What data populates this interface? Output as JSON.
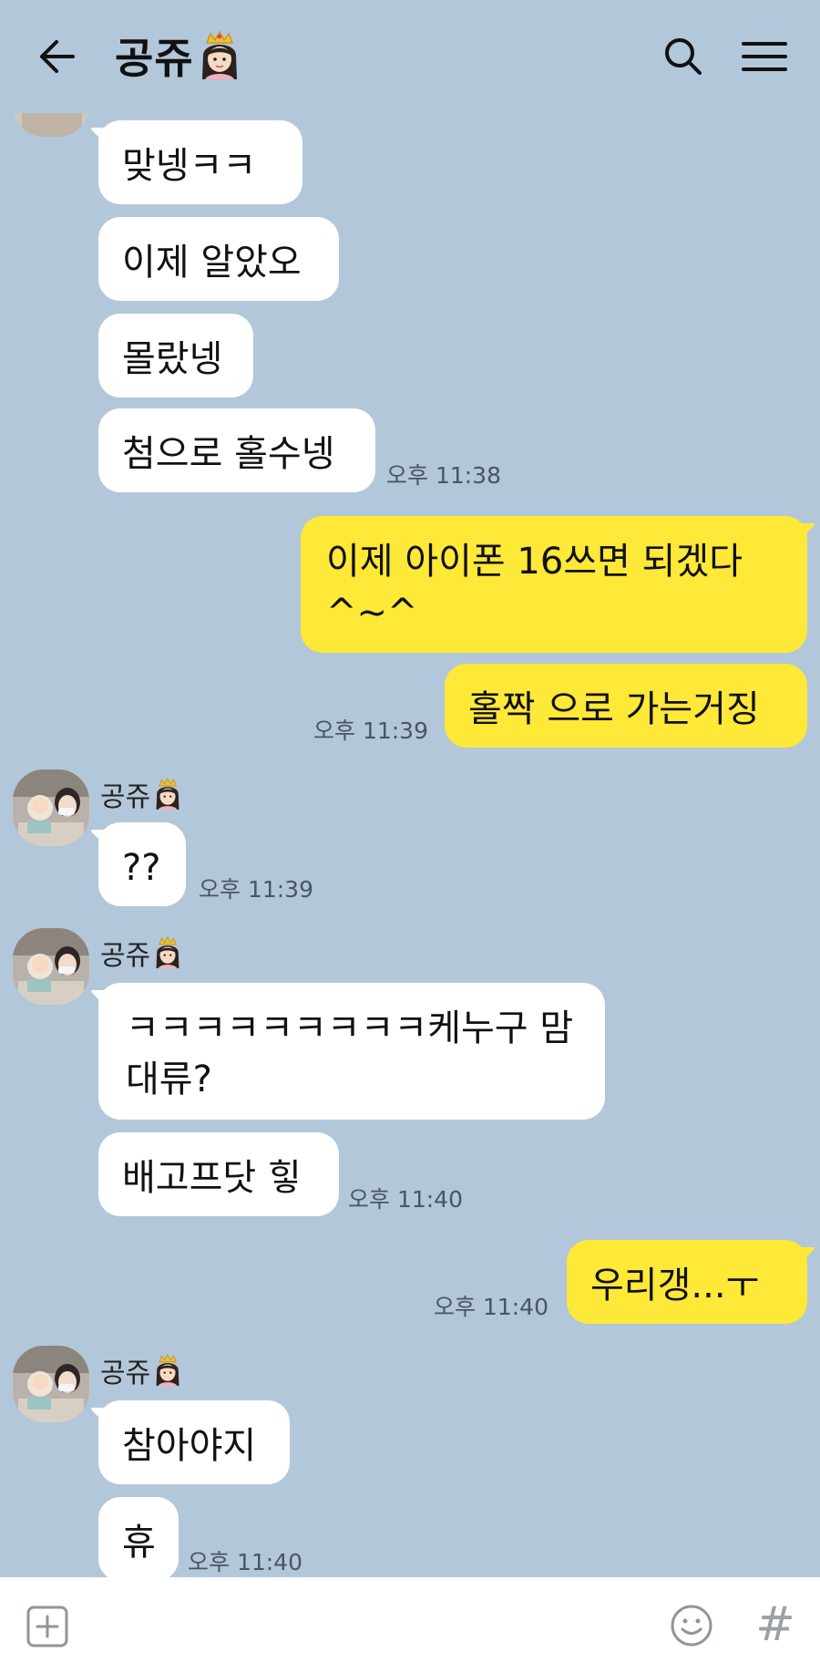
{
  "header": {
    "title": "공쥬",
    "back_icon": "arrow-left-icon",
    "search_icon": "search-icon",
    "menu_icon": "hamburger-menu-icon",
    "title_emoji": "princess-emoji"
  },
  "colors": {
    "chat_background": "#b2c7da",
    "incoming_bubble": "#ffffff",
    "outgoing_bubble": "#fee838",
    "timestamp": "#4a5564"
  },
  "contact": {
    "name": "공쥬",
    "avatar": "profile-photo"
  },
  "messages": [
    {
      "id": 0,
      "from": "them",
      "text": "맞넹ㅋㅋ"
    },
    {
      "id": 1,
      "from": "them",
      "text": "이제 알았오"
    },
    {
      "id": 2,
      "from": "them",
      "text": "몰랐넹"
    },
    {
      "id": 3,
      "from": "them",
      "text": "첨으로 홀수넹",
      "time": "오후 11:38"
    },
    {
      "id": 4,
      "from": "me",
      "text": "이제 아이폰 16쓰면 되겠다 ^~^"
    },
    {
      "id": 5,
      "from": "me",
      "text": "홀짝 으로 가는거징",
      "time": "오후 11:39"
    },
    {
      "id": 6,
      "from": "them",
      "text": "??",
      "time": "오후 11:39"
    },
    {
      "id": 7,
      "from": "them",
      "text": "ㅋㅋㅋㅋㅋㅋㅋㅋㅋ케누구 맘대류?"
    },
    {
      "id": 8,
      "from": "them",
      "text": "배고프닷 힣",
      "time": "오후 11:40"
    },
    {
      "id": 9,
      "from": "me",
      "text": "우리갱...ㅜ",
      "time": "오후 11:40"
    },
    {
      "id": 10,
      "from": "them",
      "text": "참아야지"
    },
    {
      "id": 11,
      "from": "them",
      "text": "휴",
      "time": "오후 11:40"
    }
  ],
  "input": {
    "value": "",
    "placeholder": "",
    "attach_icon": "plus-square-icon",
    "emoji_icon": "smiley-icon",
    "hash_label": "#"
  }
}
